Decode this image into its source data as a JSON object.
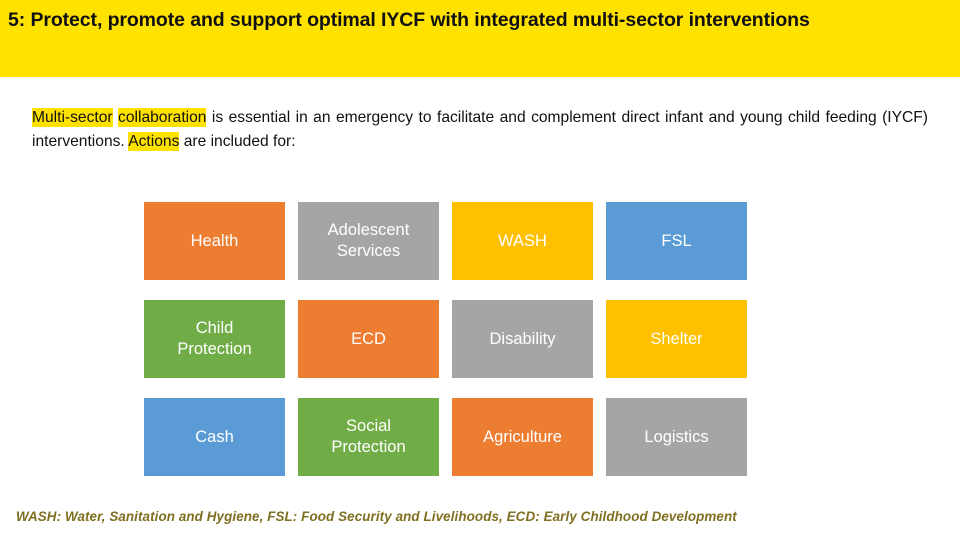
{
  "header": {
    "title": "5: Protect, promote and support optimal IYCF with integrated multi-sector interventions",
    "background_color": "#FFE200",
    "text_color": "#111111"
  },
  "body": {
    "highlight_color": "#FFE200",
    "segments": [
      {
        "text": "Multi-sector",
        "highlighted": true
      },
      {
        "text": " ",
        "highlighted": false
      },
      {
        "text": "collaboration",
        "highlighted": true
      },
      {
        "text": " is essential in an emergency to facilitate and complement direct infant and young child feeding (IYCF) interventions. ",
        "highlighted": false
      },
      {
        "text": "Actions",
        "highlighted": true
      },
      {
        "text": " are included for:",
        "highlighted": false
      }
    ],
    "line1": "Multi-sector collaboration is essential in an emergency to facilitate and complement",
    "line2": "direct infant and young child feeding (IYCF) interventions. Actions are included for:"
  },
  "sector_grid": {
    "columns": 4,
    "rows": 3,
    "palette": {
      "orange": "#ED7D31",
      "gray": "#A5A5A5",
      "amber": "#FFC000",
      "blue": "#5B9BD5",
      "green": "#70AD47"
    },
    "boxes": [
      {
        "label": "Health",
        "color": "#ED7D31"
      },
      {
        "label": "Adolescent\nServices",
        "color": "#A5A5A5"
      },
      {
        "label": "WASH",
        "color": "#FFC000"
      },
      {
        "label": "FSL",
        "color": "#5B9BD5"
      },
      {
        "label": "Child\nProtection",
        "color": "#70AD47"
      },
      {
        "label": "ECD",
        "color": "#ED7D31"
      },
      {
        "label": "Disability",
        "color": "#A5A5A5"
      },
      {
        "label": "Shelter",
        "color": "#FFC000"
      },
      {
        "label": "Cash",
        "color": "#5B9BD5"
      },
      {
        "label": "Social\nProtection",
        "color": "#70AD47"
      },
      {
        "label": "Agriculture",
        "color": "#ED7D31"
      },
      {
        "label": "Logistics",
        "color": "#A5A5A5"
      }
    ]
  },
  "footer": {
    "note": "WASH: Water, Sanitation and Hygiene, FSL: Food Security and Livelihoods, ECD: Early Childhood Development",
    "text_color": "#7F6F20"
  }
}
